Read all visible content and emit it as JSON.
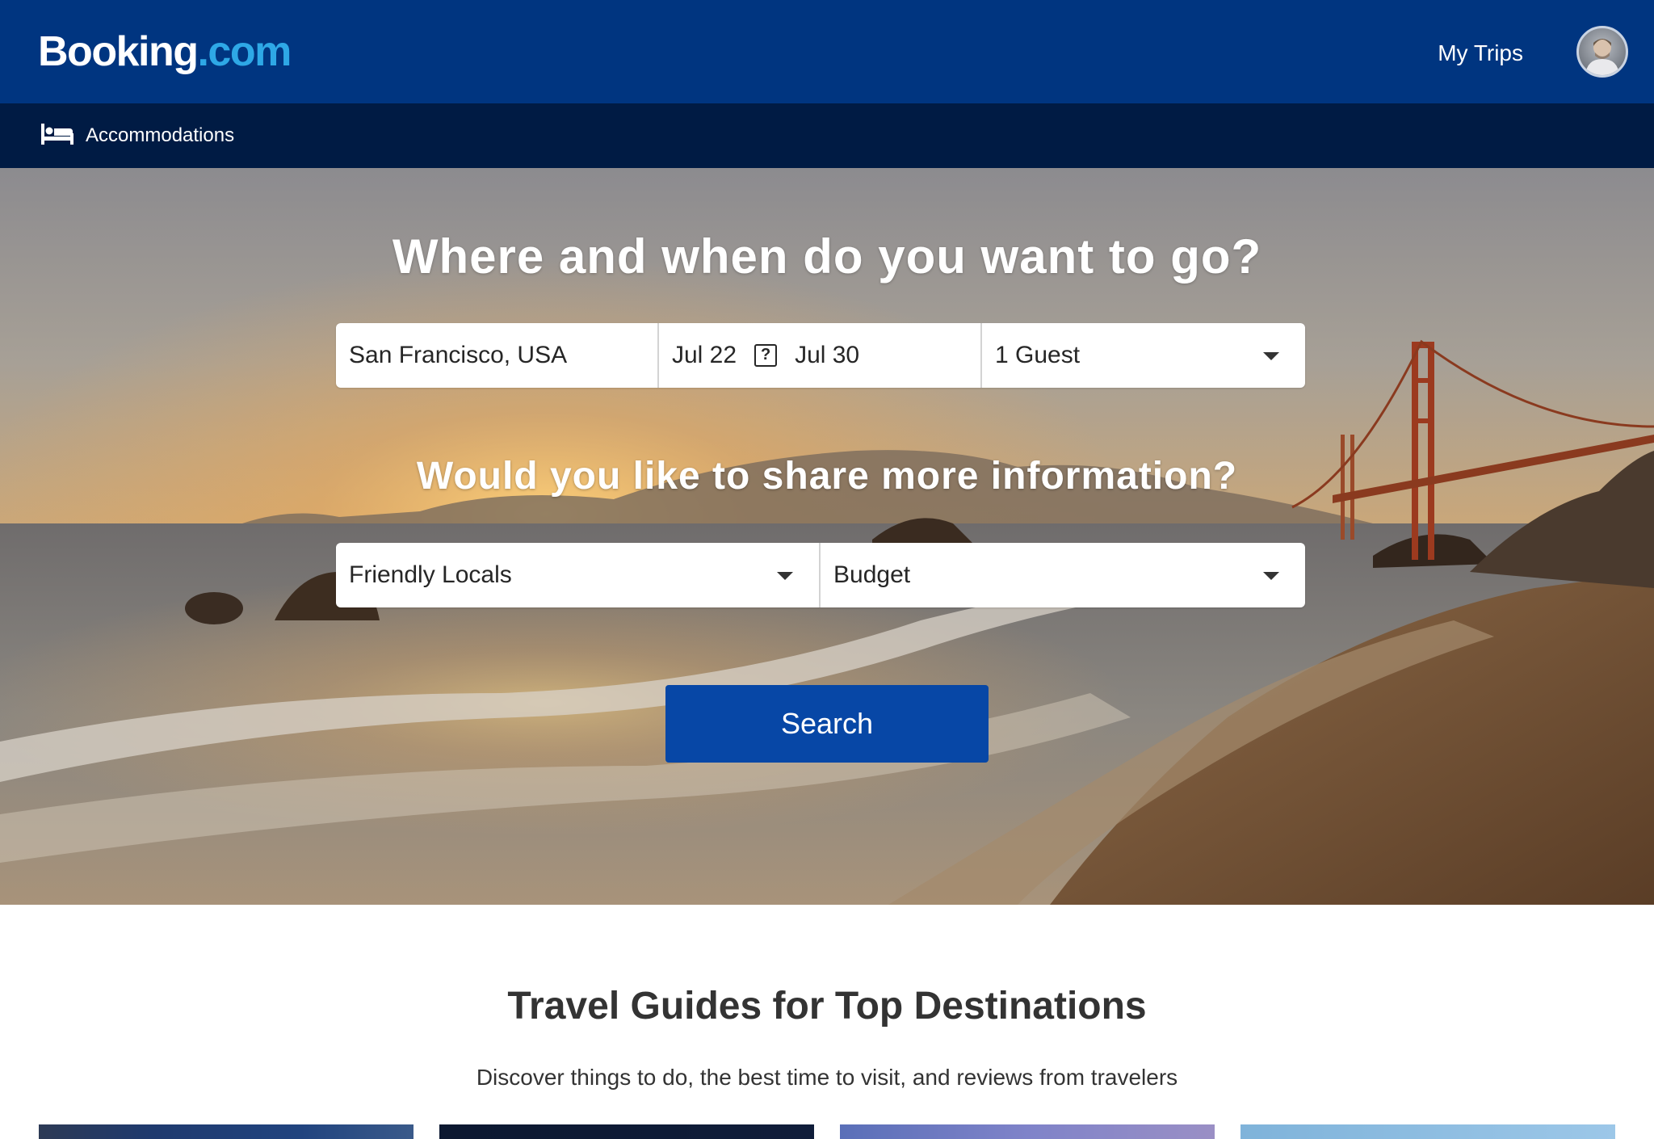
{
  "header": {
    "logo_main": "Booking",
    "logo_suffix": ".com",
    "my_trips_label": "My Trips",
    "avatar_icon": "user-avatar"
  },
  "nav": {
    "accommodations_label": "Accommodations",
    "accommodations_icon": "bed-icon"
  },
  "hero": {
    "title_part1": "Where",
    "title_part2": " and ",
    "title_part3": "when",
    "title_part4": " do you want to go?",
    "destination_value": "San Francisco, USA",
    "check_in": "Jul 22",
    "date_separator_icon": "question-box-icon",
    "date_separator_glyph": "?",
    "check_out": "Jul 30",
    "guests_value": "1 Guest",
    "subtitle": "Would you like to share more information?",
    "preference_value": "Friendly Locals",
    "budget_value": "Budget",
    "search_label": "Search"
  },
  "guides": {
    "title": "Travel Guides for Top Destinations",
    "subtitle": "Discover things to do, the best time to visit, and reviews from travelers"
  },
  "colors": {
    "brand_blue": "#003580",
    "nav_dark": "#001b44",
    "search_button": "#0747a6",
    "logo_accent": "#2ea8e6"
  }
}
